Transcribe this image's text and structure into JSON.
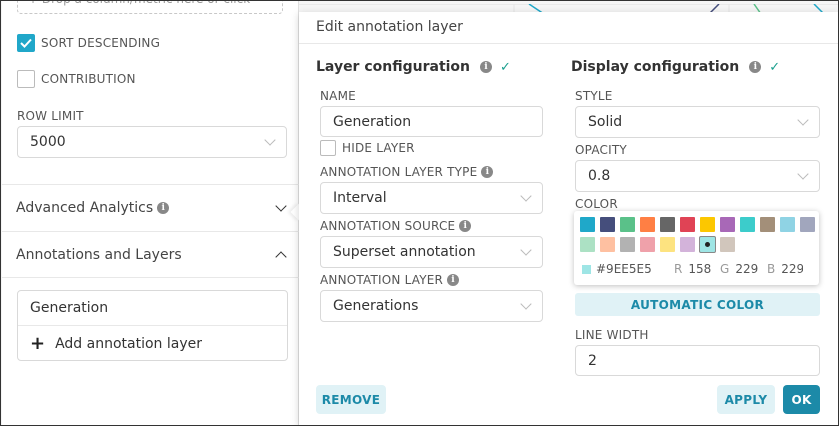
{
  "left_panel": {
    "drop_zone_text": "+ Drop a column/metric here or click",
    "sort_descending": {
      "label": "SORT DESCENDING",
      "checked": true
    },
    "contribution": {
      "label": "CONTRIBUTION",
      "checked": false
    },
    "row_limit": {
      "label": "ROW LIMIT",
      "value": "5000"
    },
    "advanced_analytics": {
      "label": "Advanced Analytics"
    },
    "annotations_and_layers": {
      "label": "Annotations and Layers"
    },
    "annotation_list": {
      "items": [
        "Generation"
      ],
      "add_label": "Add annotation layer"
    }
  },
  "popover": {
    "title": "Edit annotation layer",
    "layer_configuration": {
      "heading": "Layer configuration",
      "name_label": "NAME",
      "name_value": "Generation",
      "hide_layer_label": "HIDE LAYER",
      "hide_layer_checked": false,
      "type_label": "ANNOTATION LAYER TYPE",
      "type_value": "Interval",
      "source_label": "ANNOTATION SOURCE",
      "source_value": "Superset annotation",
      "layer_label": "ANNOTATION LAYER",
      "layer_value": "Generations"
    },
    "display_configuration": {
      "heading": "Display configuration",
      "style_label": "STYLE",
      "style_value": "Solid",
      "opacity_label": "OPACITY",
      "opacity_value": "0.8",
      "color_label": "COLOR",
      "color_picker": {
        "swatches_row1": [
          "#1FA8C9",
          "#454E7C",
          "#5AC189",
          "#FF7F44",
          "#666666",
          "#E04355",
          "#FCC700",
          "#A868B7",
          "#3CCCCB",
          "#A38F79",
          "#8FD3E4",
          "#A1A6BD"
        ],
        "swatches_row2": [
          "#ACE1C4",
          "#FEC0A1",
          "#B2B2B2",
          "#EFA1AA",
          "#FDE380",
          "#D3B3DA",
          "#9EE5E5",
          "#D1C6BC"
        ],
        "selected_color": "#9EE5E5",
        "hex_value": "#9EE5E5",
        "r_label": "R",
        "r_value": "158",
        "g_label": "G",
        "g_value": "229",
        "b_label": "B",
        "b_value": "229"
      },
      "automatic_color_label": "AUTOMATIC COLOR",
      "line_width_label": "LINE WIDTH",
      "line_width_value": "2"
    },
    "buttons": {
      "remove": "REMOVE",
      "apply": "APPLY",
      "ok": "OK"
    }
  },
  "colors": {
    "accent": "#1C8AA8",
    "accent_light": "#E0F2F6",
    "check": "#1A9F8E",
    "checkbox_checked": "#20A7C9"
  }
}
